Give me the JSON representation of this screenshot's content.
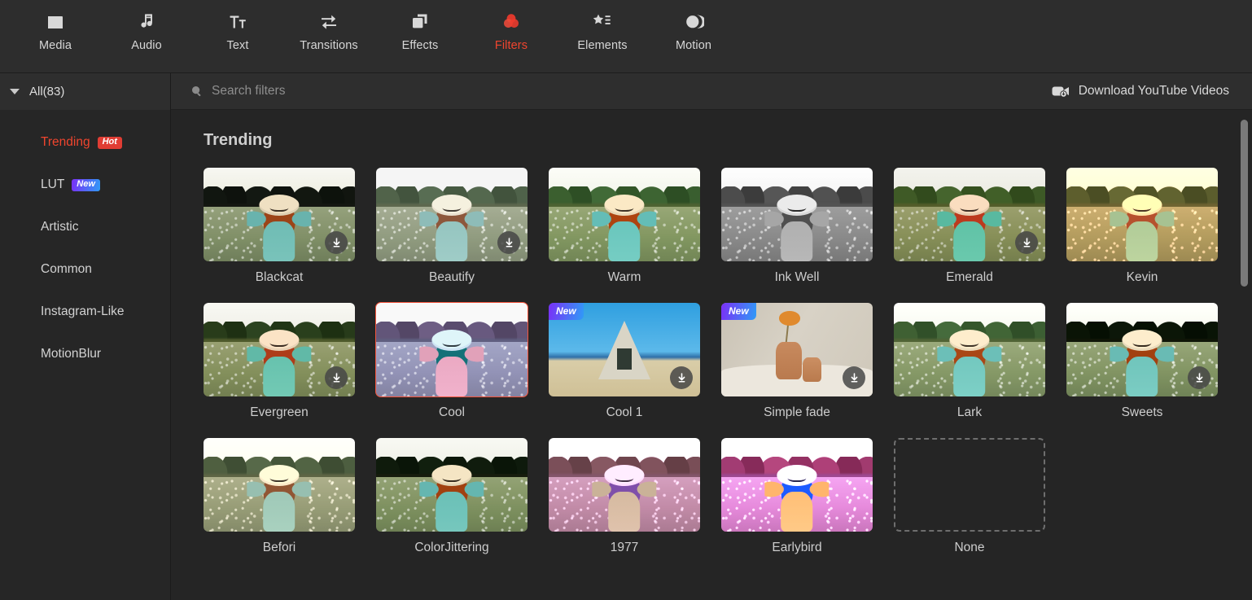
{
  "toolbar": {
    "items": [
      {
        "label": "Media",
        "icon": "folder-icon",
        "active": false
      },
      {
        "label": "Audio",
        "icon": "music-note-icon",
        "active": false
      },
      {
        "label": "Text",
        "icon": "text-icon",
        "active": false
      },
      {
        "label": "Transitions",
        "icon": "transitions-icon",
        "active": false
      },
      {
        "label": "Effects",
        "icon": "effects-icon",
        "active": false
      },
      {
        "label": "Filters",
        "icon": "filters-icon",
        "active": true
      },
      {
        "label": "Elements",
        "icon": "elements-icon",
        "active": false
      },
      {
        "label": "Motion",
        "icon": "motion-icon",
        "active": false
      }
    ],
    "active_color": "#f0452e"
  },
  "sidebar": {
    "header": {
      "label": "All(83)",
      "icon": "caret-down-icon",
      "expanded": true
    },
    "items": [
      {
        "label": "Trending",
        "badge": "Hot",
        "badge_type": "hot",
        "active": true
      },
      {
        "label": "LUT",
        "badge": "New",
        "badge_type": "new",
        "active": false
      },
      {
        "label": "Artistic",
        "badge": null,
        "badge_type": null,
        "active": false
      },
      {
        "label": "Common",
        "badge": null,
        "badge_type": null,
        "active": false
      },
      {
        "label": "Instagram-Like",
        "badge": null,
        "badge_type": null,
        "active": false
      },
      {
        "label": "MotionBlur",
        "badge": null,
        "badge_type": null,
        "active": false
      }
    ]
  },
  "search": {
    "placeholder": "Search filters",
    "value": "",
    "icon": "search-icon"
  },
  "download_link": {
    "label": "Download YouTube Videos",
    "icon": "video-download-icon"
  },
  "content": {
    "section_title": "Trending",
    "filters": [
      {
        "name": "Blackcat",
        "variant": "f-blackcat",
        "scene": "field",
        "download": true,
        "new": false,
        "selected": false
      },
      {
        "name": "Beautify",
        "variant": "f-beautify",
        "scene": "field",
        "download": true,
        "new": false,
        "selected": false
      },
      {
        "name": "Warm",
        "variant": "f-warm",
        "scene": "field",
        "download": false,
        "new": false,
        "selected": false
      },
      {
        "name": "Ink Well",
        "variant": "f-inkwell",
        "scene": "field",
        "download": false,
        "new": false,
        "selected": false
      },
      {
        "name": "Emerald",
        "variant": "f-emerald",
        "scene": "field",
        "download": true,
        "new": false,
        "selected": false
      },
      {
        "name": "Kevin",
        "variant": "f-kevin",
        "scene": "field",
        "download": false,
        "new": false,
        "selected": false
      },
      {
        "name": "Evergreen",
        "variant": "f-evergreen",
        "scene": "field",
        "download": true,
        "new": false,
        "selected": false
      },
      {
        "name": "Cool",
        "variant": "f-cool",
        "scene": "field",
        "download": false,
        "new": false,
        "selected": true
      },
      {
        "name": "Cool 1",
        "variant": "",
        "scene": "beach",
        "download": true,
        "new": true,
        "selected": false
      },
      {
        "name": "Simple fade",
        "variant": "",
        "scene": "vases",
        "download": true,
        "new": true,
        "selected": false
      },
      {
        "name": "Lark",
        "variant": "f-lark",
        "scene": "field",
        "download": false,
        "new": false,
        "selected": false
      },
      {
        "name": "Sweets",
        "variant": "f-sweets",
        "scene": "field",
        "download": true,
        "new": false,
        "selected": false
      },
      {
        "name": "Befori",
        "variant": "f-befori",
        "scene": "field",
        "download": false,
        "new": false,
        "selected": false
      },
      {
        "name": "ColorJittering",
        "variant": "f-colorjitter",
        "scene": "field",
        "download": false,
        "new": false,
        "selected": false
      },
      {
        "name": "1977",
        "variant": "f-1977",
        "scene": "field",
        "download": false,
        "new": false,
        "selected": false
      },
      {
        "name": "Earlybird",
        "variant": "f-earlybird",
        "scene": "field",
        "download": false,
        "new": false,
        "selected": false
      },
      {
        "name": "None",
        "variant": "",
        "scene": "none",
        "download": false,
        "new": false,
        "selected": false
      }
    ],
    "new_badge_label": "New",
    "selection_color": "#f4543c"
  },
  "scrollbar": {
    "visible": true
  }
}
